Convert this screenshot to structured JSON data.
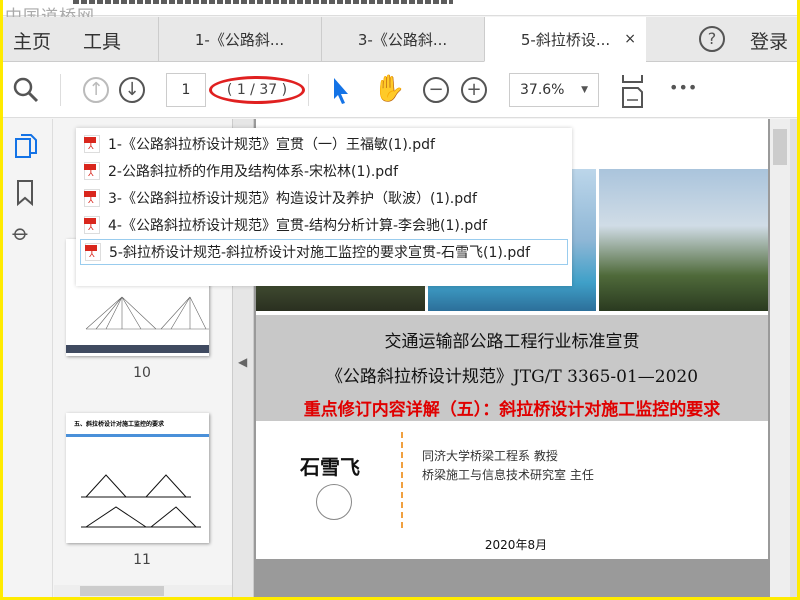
{
  "watermark": "中国道桥网",
  "tabbar": {
    "home": "主页",
    "tools": "工具",
    "tabs": [
      {
        "label": "1-《公路斜..."
      },
      {
        "label": "3-《公路斜..."
      },
      {
        "label": "5-斜拉桥设...",
        "close": "×"
      }
    ],
    "help": "?",
    "login": "登录"
  },
  "toolbar": {
    "page_value": "1",
    "page_count": "( 1 / 37 )",
    "zoom": "37.6%",
    "more": "•••"
  },
  "thumbs": [
    {
      "number": "10"
    },
    {
      "number": "11",
      "heading": "五、斜拉桥设计对施工监控的要求"
    }
  ],
  "menu": {
    "items": [
      {
        "label": "1-《公路斜拉桥设计规范》宣贯（一）王福敏(1).pdf"
      },
      {
        "label": "2-公路斜拉桥的作用及结构体系-宋松林(1).pdf"
      },
      {
        "label": "3-《公路斜拉桥设计规范》构造设计及养护（耿波）(1).pdf"
      },
      {
        "label": "4-《公路斜拉桥设计规范》宣贯-结构分析计算-李会驰(1).pdf"
      },
      {
        "label": "5-斜拉桥设计规范-斜拉桥设计对施工监控的要求宣贯-石雪飞(1).pdf",
        "selected": true
      }
    ]
  },
  "page": {
    "line1": "交通运输部公路工程行业标准宣贯",
    "line2": "《公路斜拉桥设计规范》JTG/T 3365-01—2020",
    "line3": "重点修订内容详解（五）：斜拉桥设计对施工监控的要求",
    "author": "石雪飞",
    "aff1": "同济大学桥梁工程系  教授",
    "aff2": "桥梁施工与信息技术研究室  主任",
    "date": "2020年8月"
  },
  "colors": {
    "accent": "#1473e6",
    "highlight_circle": "#e02020",
    "title_red": "#e00000",
    "border": "#ffeb00"
  }
}
